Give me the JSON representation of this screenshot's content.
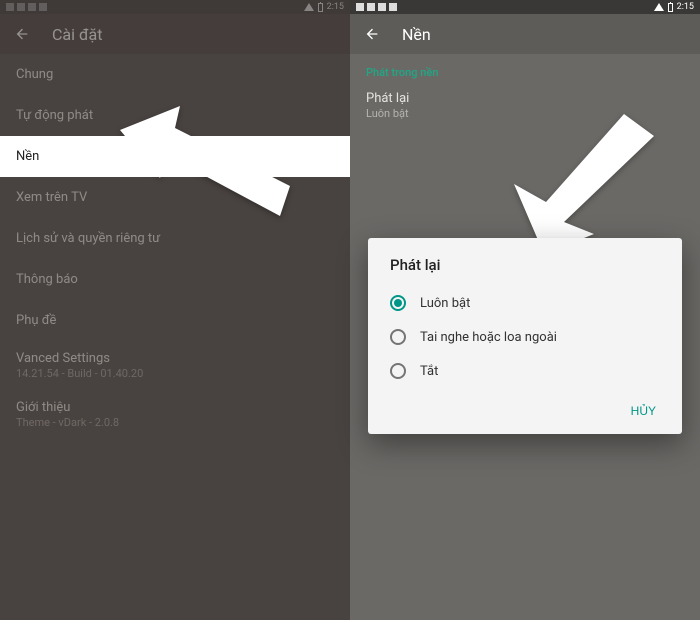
{
  "status_time": "2:15",
  "left": {
    "header_title": "Cài đặt",
    "items": [
      {
        "label": "Chung"
      },
      {
        "label": "Tự động phát"
      },
      {
        "label": "Nền",
        "highlighted": true
      },
      {
        "label": "Xem trên TV"
      },
      {
        "label": "Lịch sử và quyền riêng tư"
      },
      {
        "label": "Thông báo"
      },
      {
        "label": "Phụ đề"
      }
    ],
    "multi": [
      {
        "title": "Vanced Settings",
        "sub": "14.21.54 - Build - 01.40.20"
      },
      {
        "title": "Giới thiệu",
        "sub": "Theme - vDark - 2.0.8"
      }
    ]
  },
  "right": {
    "header_title": "Nền",
    "section_title": "Phát trong nền",
    "setting": {
      "title": "Phát lại",
      "sub": "Luôn bật"
    },
    "dialog": {
      "title": "Phát lại",
      "options": [
        {
          "label": "Luôn bật",
          "checked": true
        },
        {
          "label": "Tai nghe hoặc loa ngoài",
          "checked": false
        },
        {
          "label": "Tắt",
          "checked": false
        }
      ],
      "cancel": "HỦY"
    }
  }
}
